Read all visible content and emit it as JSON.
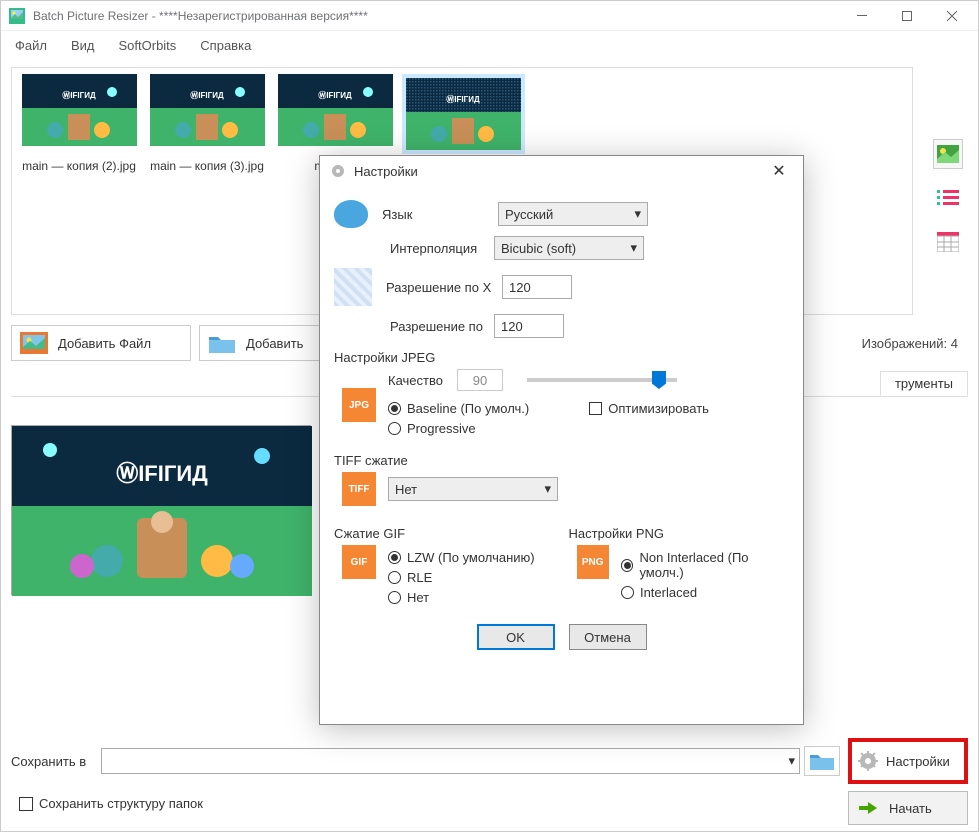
{
  "window": {
    "title": "Batch Picture Resizer - ****Незарегистрированная версия****"
  },
  "menu": {
    "file": "Файл",
    "view": "Вид",
    "softorbits": "SoftOrbits",
    "help": "Справка"
  },
  "thumbs": [
    {
      "label": "main — копия (2).jpg"
    },
    {
      "label": "main — копия (3).jpg"
    },
    {
      "label": "main —"
    },
    {
      "label": ""
    }
  ],
  "actions": {
    "add_file": "Добавить Файл",
    "add_folder": "Добавить",
    "images_count_label": "Изображений: 4"
  },
  "tab_tools": "трументы",
  "save": {
    "label": "Сохранить в",
    "keep_structure": "Сохранить структуру папок"
  },
  "buttons": {
    "settings": "Настройки",
    "start": "Начать"
  },
  "dialog": {
    "title": "Настройки",
    "language_label": "Язык",
    "language_value": "Русский",
    "interp_label": "Интерполяция",
    "interp_value": "Bicubic (soft)",
    "res_x_label": "Разрешение по X",
    "res_x_value": "120",
    "res_y_label": "Разрешение по",
    "res_y_value": "120",
    "jpeg_section": "Настройки JPEG",
    "quality_label": "Качество",
    "quality_value": "90",
    "baseline": "Baseline (По умолч.)",
    "optimize": "Оптимизировать",
    "progressive": "Progressive",
    "tiff_section": "TIFF сжатие",
    "tiff_value": "Нет",
    "gif_section": "Сжатие GIF",
    "gif_lzw": "LZW (По умолчанию)",
    "gif_rle": "RLE",
    "gif_none": "Нет",
    "png_section": "Настройки PNG",
    "png_noninterlaced": "Non Interlaced (По умолч.)",
    "png_interlaced": "Interlaced",
    "ok": "OK",
    "cancel": "Отмена",
    "jpg_badge": "JPG",
    "tiff_badge": "TIFF",
    "gif_badge": "GIF",
    "png_badge": "PNG"
  }
}
